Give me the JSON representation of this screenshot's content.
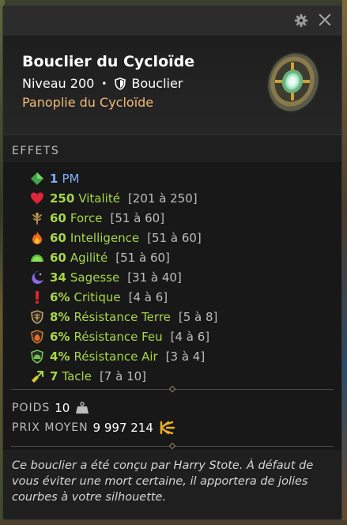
{
  "window": {
    "settings_icon": "gear-icon",
    "close_icon": "close-icon"
  },
  "item": {
    "name": "Bouclier du Cycloïde",
    "level": "Niveau 200",
    "separator": "•",
    "type": "Bouclier",
    "type_icon": "shield-icon",
    "set": "Panoplie du Cycloïde",
    "image_icon": "round-shield-icon"
  },
  "effects_title": "EFFETS",
  "effects": [
    {
      "icon": "mp-diamond-icon",
      "value": "1",
      "name": "PM",
      "range": ""
    },
    {
      "icon": "heart-icon",
      "value": "250",
      "name": "Vitalité",
      "range": "[201 à 250]"
    },
    {
      "icon": "strength-icon",
      "value": "60",
      "name": "Force",
      "range": "[51 à 60]"
    },
    {
      "icon": "fire-icon",
      "value": "60",
      "name": "Intelligence",
      "range": "[51 à 60]"
    },
    {
      "icon": "agility-icon",
      "value": "60",
      "name": "Agilité",
      "range": "[51 à 60]"
    },
    {
      "icon": "wisdom-icon",
      "value": "34",
      "name": "Sagesse",
      "range": "[31 à 40]"
    },
    {
      "icon": "critical-icon",
      "value": "6%",
      "name": "Critique",
      "range": "[4 à 6]"
    },
    {
      "icon": "earth-resistance-icon",
      "value": "8%",
      "name": "Résistance Terre",
      "range": "[5 à 8]"
    },
    {
      "icon": "fire-resistance-icon",
      "value": "6%",
      "name": "Résistance Feu",
      "range": "[4 à 6]"
    },
    {
      "icon": "air-resistance-icon",
      "value": "4%",
      "name": "Résistance Air",
      "range": "[3 à 4]"
    },
    {
      "icon": "lock-icon",
      "value": "7",
      "name": "Tacle",
      "range": "[7 à 10]"
    }
  ],
  "info": {
    "weight_label": "POIDS",
    "weight_value": "10",
    "weight_icon": "weight-icon",
    "price_label": "PRIX MOYEN",
    "price_value": "9 997 214",
    "price_icon": "kamas-icon"
  },
  "description": "Ce bouclier a été conçu par Harry Stote. À défaut de vous éviter une mort certaine, il apportera de jolies courbes à votre silhouette.",
  "colors": {
    "effect_green": "#a6d64a",
    "mp_blue": "#7fb2ff",
    "set_orange": "#f2b978",
    "panel_bg": "#232323"
  }
}
